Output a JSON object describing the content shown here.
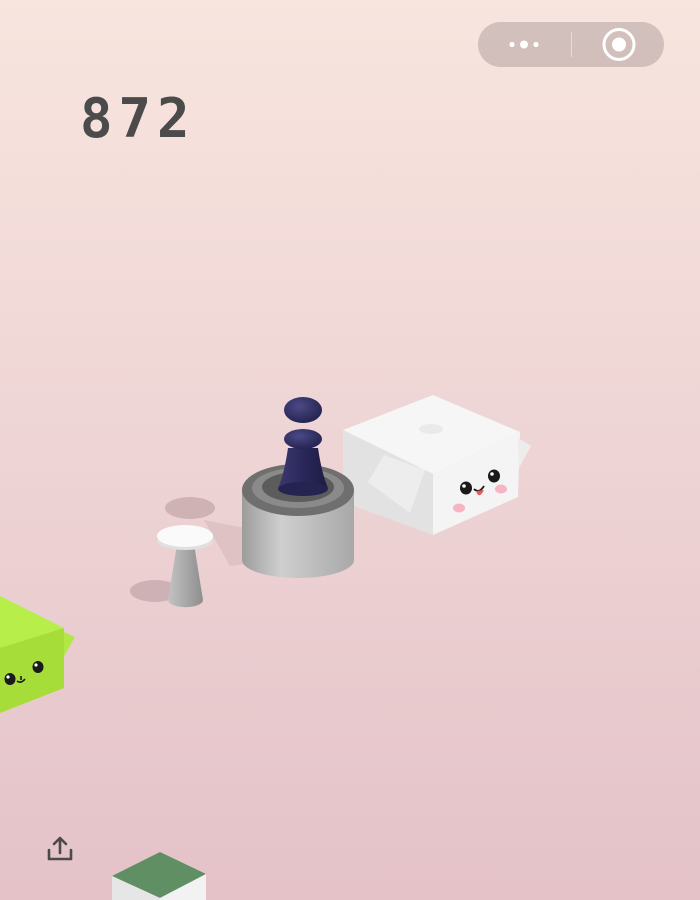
{
  "hud": {
    "score": "872"
  },
  "menu_capsule": {
    "more_icon": "more-dots-icon",
    "close_icon": "target-close-icon"
  },
  "share": {
    "icon": "share-upload-icon"
  },
  "colors": {
    "background_top": "#f8e5de",
    "background_bottom": "#e4c2c8",
    "score_text": "#4b4b4b",
    "player_piece": "#2f2d5c",
    "white_cube": "#f5f5f5",
    "green_cube": "#a8e23a",
    "dark_green_block": "#5f8f62",
    "cylinder_platform": "#b9b9b9",
    "small_stool": "#a9a9a9"
  }
}
